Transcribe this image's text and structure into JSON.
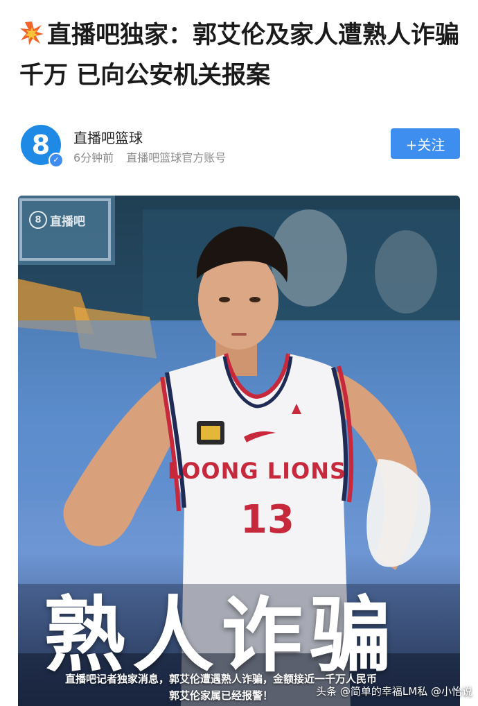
{
  "article": {
    "title": "直播吧独家：郭艾伦及家人遭熟人诈骗千万 已向公安机关报案"
  },
  "author": {
    "avatar_text": "8",
    "name": "直播吧篮球",
    "time": "6分钟前",
    "account_desc": "直播吧篮球官方账号",
    "follow_label": "+关注"
  },
  "hero": {
    "watermark": "直播吧",
    "jersey_brand": "LOONG LIONS",
    "jersey_number": "13",
    "overlay_title": "熟人诈骗",
    "caption_line1": "直播吧记者独家消息，郭艾伦遭遇熟人诈骗，金额接近一千万人民币",
    "caption_line2": "郭艾伦家属已经报警！",
    "source_tag": "头条 @简单的幸福LM私 @小怡说"
  },
  "icons": {
    "title_burst": "collision-icon",
    "verified": "verified-check-icon"
  },
  "colors": {
    "accent": "#3e8ef0",
    "avatar": "#1e8ae6",
    "jersey_trim": "#c8283c"
  }
}
